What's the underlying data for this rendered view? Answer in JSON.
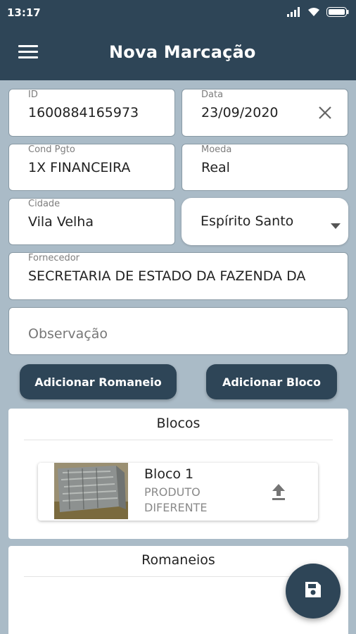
{
  "status_bar": {
    "time": "13:17",
    "icons": [
      "signal-icon",
      "wifi-icon",
      "battery-icon"
    ]
  },
  "app_bar": {
    "title": "Nova Marcação",
    "menu_icon": "menu-icon"
  },
  "form": {
    "id": {
      "label": "ID",
      "value": "1600884165973"
    },
    "data": {
      "label": "Data",
      "value": "23/09/2020"
    },
    "cond_pgto": {
      "label": "Cond Pgto",
      "value": "1X FINANCEIRA"
    },
    "moeda": {
      "label": "Moeda",
      "value": "Real"
    },
    "cidade": {
      "label": "Cidade",
      "value": "Vila Velha"
    },
    "estado": {
      "value": "Espírito Santo"
    },
    "fornecedor": {
      "label": "Fornecedor",
      "value": "SECRETARIA DE ESTADO DA FAZENDA DA"
    },
    "observacao": {
      "placeholder": "Observação"
    }
  },
  "actions": {
    "add_romaneio": "Adicionar Romaneio",
    "add_bloco": "Adicionar Bloco"
  },
  "blocos": {
    "heading": "Blocos",
    "items": [
      {
        "name": "Bloco 1",
        "description": "PRODUTO DIFERENTE"
      }
    ]
  },
  "romaneios": {
    "heading": "Romaneios"
  },
  "colors": {
    "primary": "#2e4557",
    "background": "#aabbc7"
  }
}
